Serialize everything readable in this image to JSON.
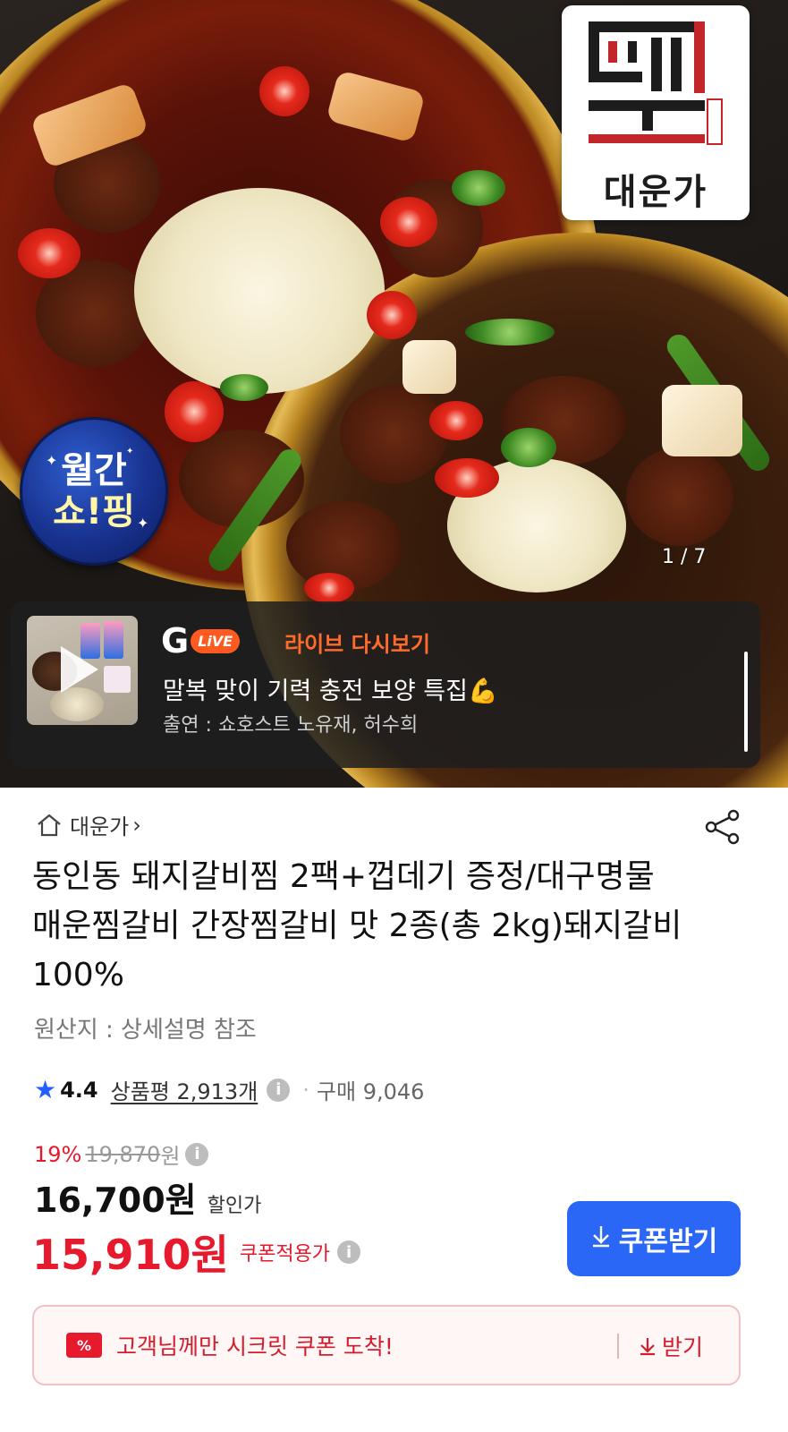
{
  "hero": {
    "brand_logo_text": "대운가",
    "brand_logo_seal": "待鶴齋",
    "monthly_badge": {
      "line1": "월간",
      "line2": "쇼!핑"
    },
    "page_indicator": "1 / 7"
  },
  "live": {
    "logo_g": "G",
    "logo_live": "LiVE",
    "replay_label": "라이브 다시보기",
    "title": "말복 맞이 기력 충전 보양 특집💪",
    "host": "출연 : 쇼호스트 노유재, 허수희"
  },
  "store": {
    "name": "대운가",
    "chevron": "›"
  },
  "product": {
    "title": "동인동 돼지갈비찜 2팩+껍데기 증정/대구명물 매운찜갈비 간장찜갈비 맛 2종(총 2kg)돼지갈비 100%",
    "origin": "원산지 : 상세설명 참조"
  },
  "rating": {
    "score": "4.4",
    "reviews": "상품평 2,913개",
    "purchase": "구매 9,046",
    "separator": "·"
  },
  "price": {
    "discount_rate": "19%",
    "original": "19,870",
    "original_unit": "원",
    "sale": "16,700원",
    "sale_label": "할인가",
    "coupon": "15,910원",
    "coupon_label": "쿠폰적용가"
  },
  "coupon_button": {
    "label": "쿠폰받기"
  },
  "secret_coupon": {
    "badge": "%",
    "text": "고객님께만 시크릿 쿠폰 도착!",
    "receive": "받기"
  },
  "colors": {
    "accent_blue": "#2a67f6",
    "price_red": "#e6192d",
    "live_orange": "#ff5a1f"
  },
  "icons": [
    "home-icon",
    "share-icon",
    "star-icon",
    "info-icon",
    "play-icon",
    "download-icon",
    "ticket-icon"
  ]
}
